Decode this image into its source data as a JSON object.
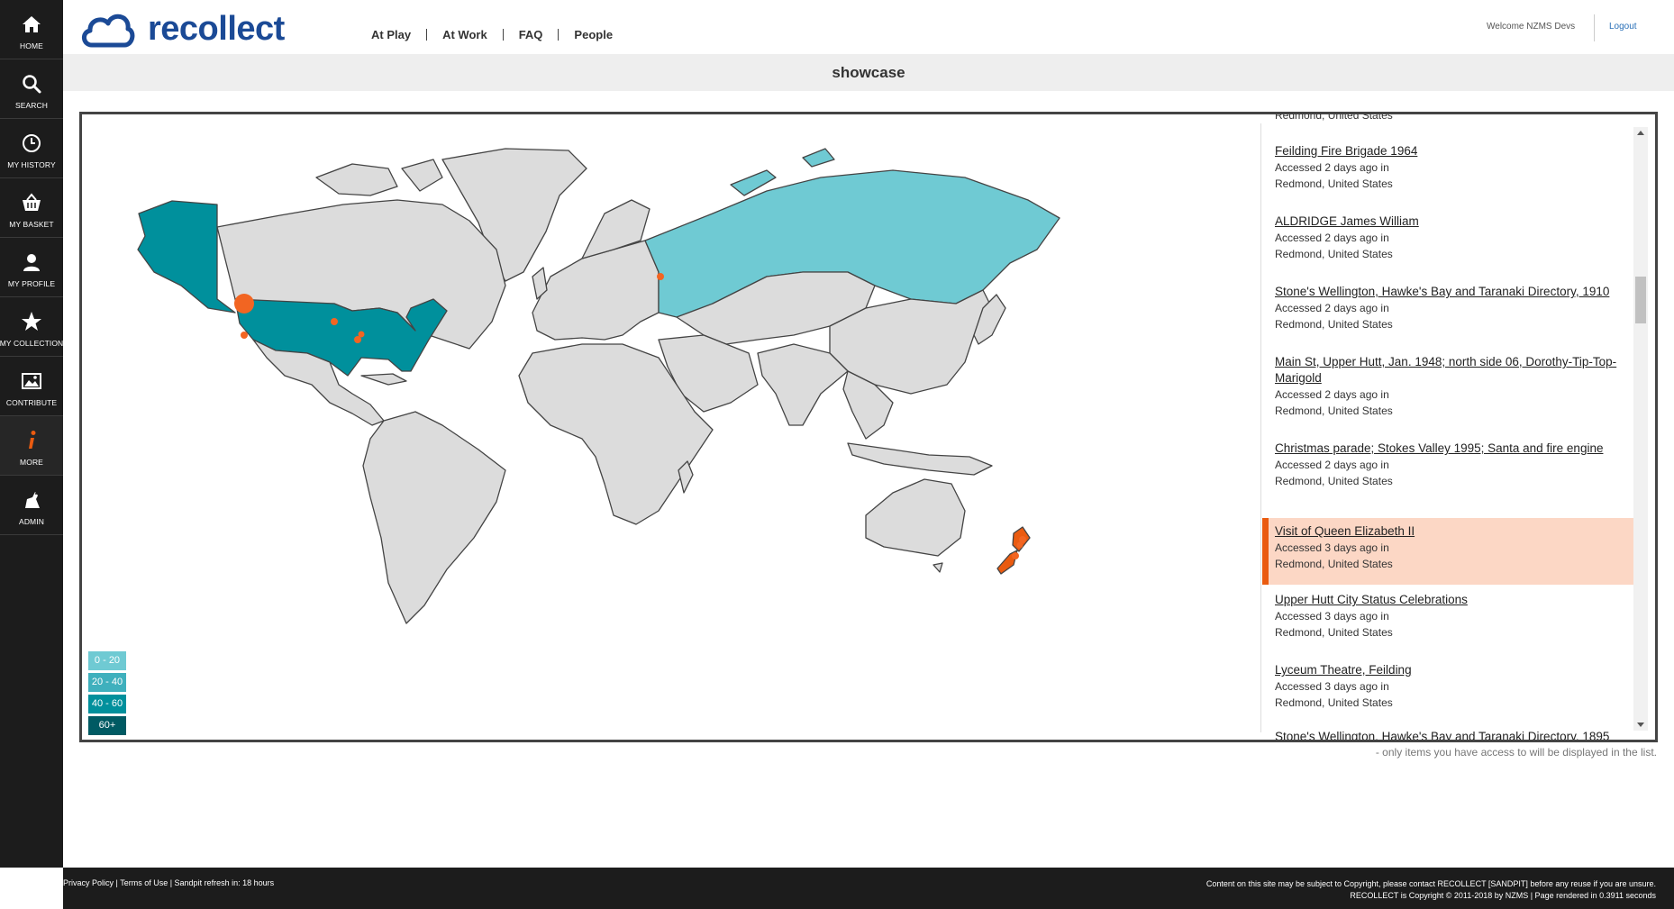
{
  "sidebar": {
    "items": [
      {
        "label": "HOME",
        "icon": "home-icon"
      },
      {
        "label": "SEARCH",
        "icon": "search-icon"
      },
      {
        "label": "MY HISTORY",
        "icon": "clock-icon"
      },
      {
        "label": "MY BASKET",
        "icon": "basket-icon"
      },
      {
        "label": "MY PROFILE",
        "icon": "user-icon"
      },
      {
        "label": "MY COLLECTION",
        "icon": "star-icon"
      },
      {
        "label": "CONTRIBUTE",
        "icon": "image-icon"
      },
      {
        "label": "MORE",
        "icon": "info-icon"
      },
      {
        "label": "ADMIN",
        "icon": "admin-icon"
      }
    ]
  },
  "header": {
    "logo_text": "recollect",
    "nav": [
      "At Play",
      "At Work",
      "FAQ",
      "People"
    ],
    "welcome": "Welcome NZMS Devs",
    "logout": "Logout"
  },
  "page": {
    "title": "showcase"
  },
  "map": {
    "legend": [
      {
        "label": "0 - 20",
        "color": "#6fcad3"
      },
      {
        "label": "20 - 40",
        "color": "#3fb0bd"
      },
      {
        "label": "40 - 60",
        "color": "#00909c"
      },
      {
        "label": "60+",
        "color": "#005a63"
      }
    ],
    "colors": {
      "default_land": "#dcdcdc",
      "usa_alaska": "#00909c",
      "russia": "#6fcad3",
      "nz": "#ea5b10",
      "marker": "#f26522"
    }
  },
  "history": {
    "items": [
      {
        "title": "",
        "meta1": "",
        "meta2": "Redmond, United States"
      },
      {
        "title": "Feilding Fire Brigade 1964",
        "meta1": "Accessed 2 days ago in",
        "meta2": "Redmond, United States"
      },
      {
        "title": "ALDRIDGE James William",
        "meta1": "Accessed 2 days ago in",
        "meta2": "Redmond, United States"
      },
      {
        "title": "Stone's Wellington, Hawke's Bay and Taranaki Directory, 1910",
        "meta1": "Accessed 2 days ago in",
        "meta2": "Redmond, United States"
      },
      {
        "title": "Main St, Upper Hutt, Jan. 1948; north side 06, Dorothy-Tip-Top-Marigold",
        "meta1": "Accessed 2 days ago in",
        "meta2": "Redmond, United States"
      },
      {
        "title": "Christmas parade; Stokes Valley 1995; Santa and fire engine",
        "meta1": "Accessed 2 days ago in",
        "meta2": "Redmond, United States"
      },
      {
        "title": "Visit of Queen Elizabeth II",
        "meta1": "Accessed 3 days ago in",
        "meta2": "Redmond, United States"
      },
      {
        "title": "Upper Hutt City Status Celebrations",
        "meta1": "Accessed 3 days ago in",
        "meta2": "Redmond, United States"
      },
      {
        "title": "Lyceum Theatre, Feilding",
        "meta1": "Accessed 3 days ago in",
        "meta2": "Redmond, United States"
      },
      {
        "title": "Stone's Wellington, Hawke's Bay and Taranaki Directory, 1895",
        "meta1": "",
        "meta2": ""
      }
    ],
    "note": "- only items you have access to will be displayed in the list."
  },
  "footer": {
    "left": "Privacy Policy | Terms of Use | Sandpit refresh in: 18 hours",
    "right1": "Content on this site may be subject to Copyright, please contact RECOLLECT [SANDPIT] before any reuse if you are unsure.",
    "right2": "RECOLLECT is Copyright © 2011-2018 by NZMS | Page rendered in 0.3911 seconds"
  }
}
